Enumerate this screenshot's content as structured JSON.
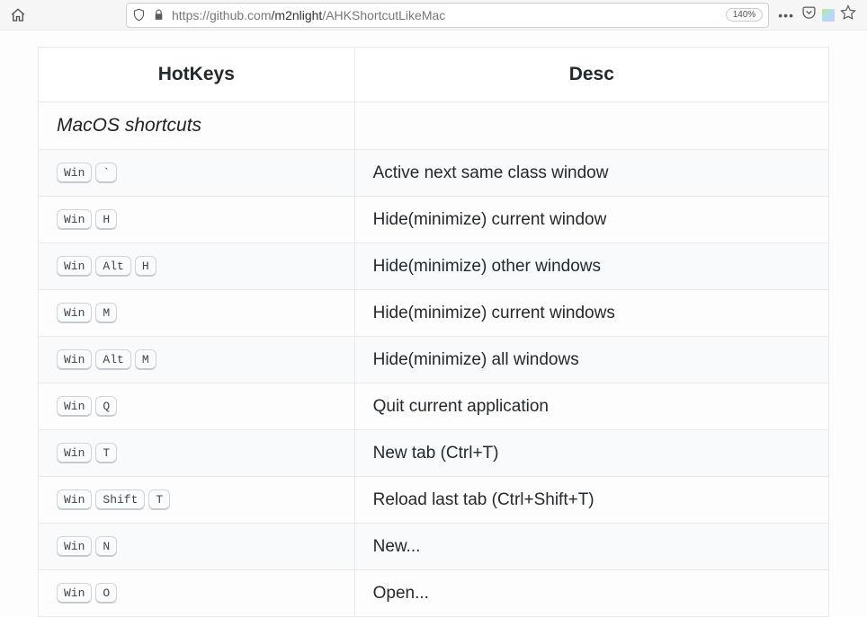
{
  "toolbar": {
    "url_host": "https://github.com",
    "url_path1": "/m2nlight",
    "url_path2": "/AHKShortcutLikeMac",
    "zoom": "140%"
  },
  "table": {
    "headers": {
      "hotkeys": "HotKeys",
      "desc": "Desc"
    },
    "section_title": "MacOS shortcuts",
    "rows": [
      {
        "keys": [
          "Win",
          "`"
        ],
        "desc": "Active next same class window"
      },
      {
        "keys": [
          "Win",
          "H"
        ],
        "desc": "Hide(minimize) current window"
      },
      {
        "keys": [
          "Win",
          "Alt",
          "H"
        ],
        "desc": "Hide(minimize) other windows"
      },
      {
        "keys": [
          "Win",
          "M"
        ],
        "desc": "Hide(minimize) current windows"
      },
      {
        "keys": [
          "Win",
          "Alt",
          "M"
        ],
        "desc": "Hide(minimize) all windows"
      },
      {
        "keys": [
          "Win",
          "Q"
        ],
        "desc": "Quit current application"
      },
      {
        "keys": [
          "Win",
          "T"
        ],
        "desc": "New tab (Ctrl+T)"
      },
      {
        "keys": [
          "Win",
          "Shift",
          "T"
        ],
        "desc": "Reload last tab (Ctrl+Shift+T)"
      },
      {
        "keys": [
          "Win",
          "N"
        ],
        "desc": "New..."
      },
      {
        "keys": [
          "Win",
          "O"
        ],
        "desc": "Open..."
      }
    ]
  }
}
